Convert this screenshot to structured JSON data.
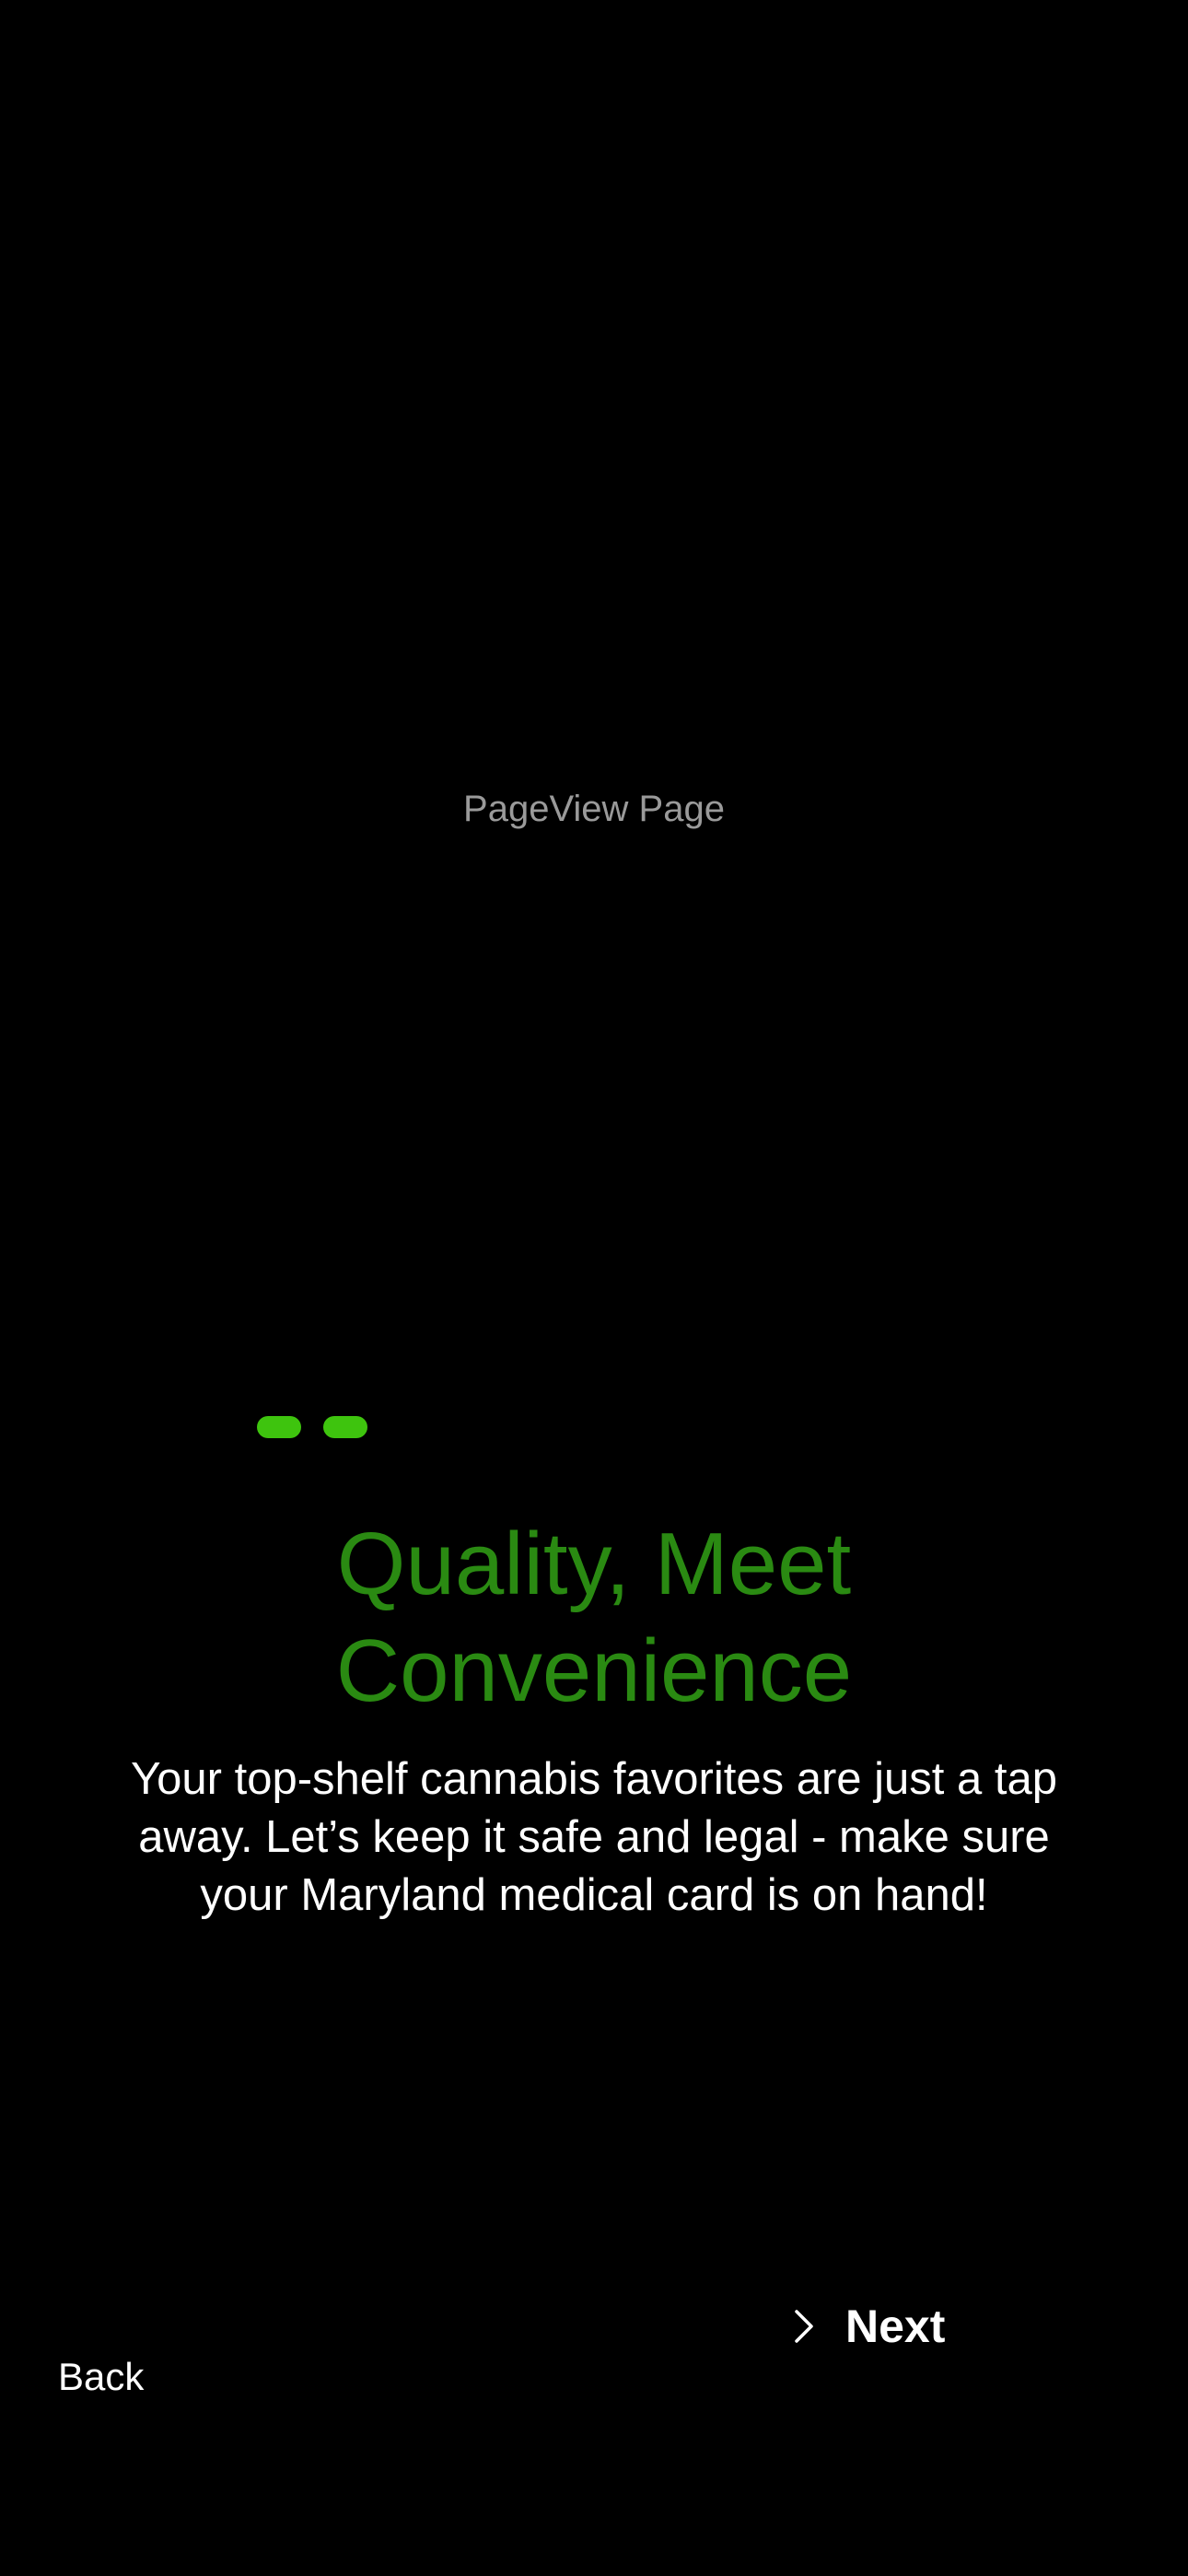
{
  "pageview": {
    "placeholder_text": "PageView Page"
  },
  "indicator": {
    "dot_count": 2,
    "color": "#3ec40e"
  },
  "onboarding": {
    "title_line1": "Quality, Meet",
    "title_line2": "Convenience",
    "title_color": "#2a8a12",
    "body_line1": "Your top-shelf cannabis favorites are just a tap",
    "body_line2": "away. Let’s keep it safe and legal - make sure",
    "body_line3": "your Maryland medical card is on hand!"
  },
  "navigation": {
    "next_label": "Next",
    "next_icon": "chevron-right-icon",
    "back_label": "Back"
  }
}
